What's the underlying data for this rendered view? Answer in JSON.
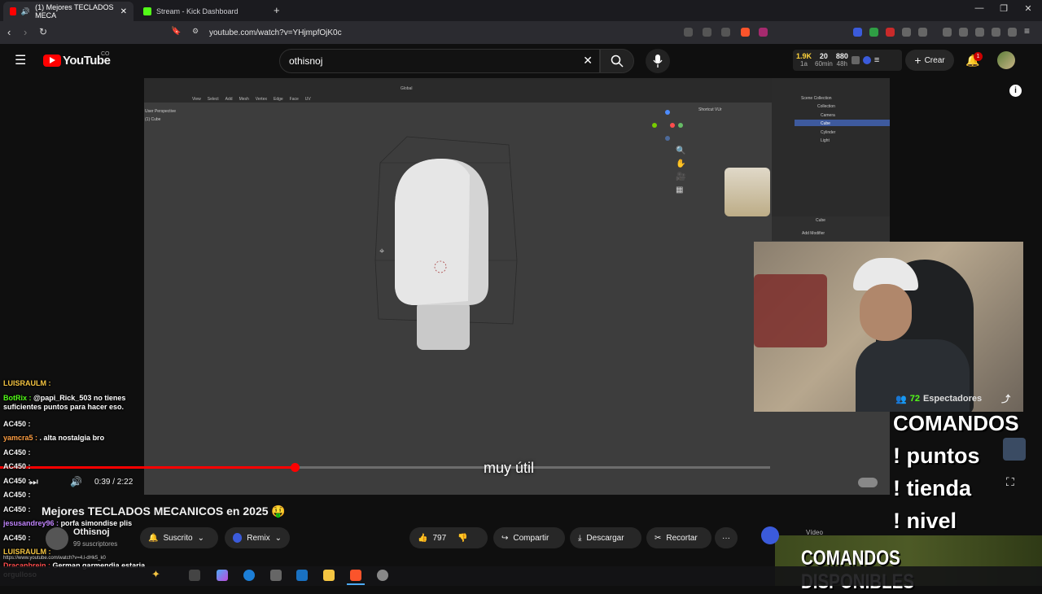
{
  "browser": {
    "tabs": [
      {
        "label": "(1) Mejores TECLADOS MECA",
        "active": true
      },
      {
        "label": "Stream - Kick Dashboard",
        "active": false
      }
    ],
    "new_tab": "+",
    "url": "youtube.com/watch?v=YHjmpfOjK0c"
  },
  "youtube": {
    "logo": "YouTube",
    "country": "CO",
    "search_value": "othisnoj",
    "ext_stats": {
      "a": "1.9K",
      "a_sub": "1a",
      "b": "20",
      "b_sub": "60min",
      "c": "880",
      "c_sub": "48h"
    },
    "create_label": "Crear",
    "notif_count": "1"
  },
  "video": {
    "subtitle": "muy útil",
    "time": "0:39 / 2:22",
    "progress": 0.276,
    "blender": {
      "perspective": "User Perspective",
      "object": "(1) Cube",
      "menu": [
        "View",
        "Select",
        "Add",
        "Mesh",
        "Vertex",
        "Edge",
        "Face",
        "UV"
      ],
      "outliner": [
        "Scene Collection",
        "Collection",
        "Camera",
        "Cube",
        "Cylinder",
        "Light"
      ],
      "shortcut": "Shortcut VUr",
      "properties": "Cube",
      "modifier": "Add Modifier",
      "transform": "Global"
    }
  },
  "overlay": {
    "viewers_count": "72",
    "viewers_label": "Espectadores",
    "commands": [
      "COMANDOS",
      "! puntos",
      "! tienda",
      "! nivel"
    ],
    "banner": "COMANDOS DISPONIBLES",
    "chat": [
      {
        "user": "LUISRAULM :",
        "msg": ""
      },
      {
        "user": "BotRix :",
        "msg": "@papi_Rick_503 no tienes suficientes puntos para hacer eso."
      },
      {
        "user": "AC450 :",
        "msg": ""
      },
      {
        "user": "yamcra5 :",
        "msg": ". alta nostalgia bro"
      },
      {
        "user": "AC450 :",
        "msg": ""
      },
      {
        "user": "AC450 :",
        "msg": ""
      },
      {
        "user": "AC450 :",
        "msg": ""
      },
      {
        "user": "AC450 :",
        "msg": ""
      },
      {
        "user": "AC450 :",
        "msg": ""
      },
      {
        "user": "jesusandrey96 :",
        "msg": "porfa simondise plis"
      },
      {
        "user": "AC450 :",
        "msg": ""
      },
      {
        "user": "LUISRAULM :",
        "msg": ""
      },
      {
        "user": "Dracanbrein :",
        "msg": "German garmendia estaria orgulloso"
      }
    ],
    "link": "https://www.youtube.com/watch?v=4.l-dHk5_k0"
  },
  "below": {
    "title": "Mejores TECLADOS MECANICOS en 2025",
    "channel": "Othisnoj",
    "subs": "99 suscriptores",
    "subscribed": "Suscrito",
    "remix": "Remix",
    "likes": "797",
    "share": "Compartir",
    "download": "Descargar",
    "clip": "Recortar",
    "more": "···",
    "tabs_hint": "Vídeo"
  },
  "colors": {
    "accent": "#ff0000",
    "kick": "#53fc18",
    "brave": "#fb542b"
  }
}
